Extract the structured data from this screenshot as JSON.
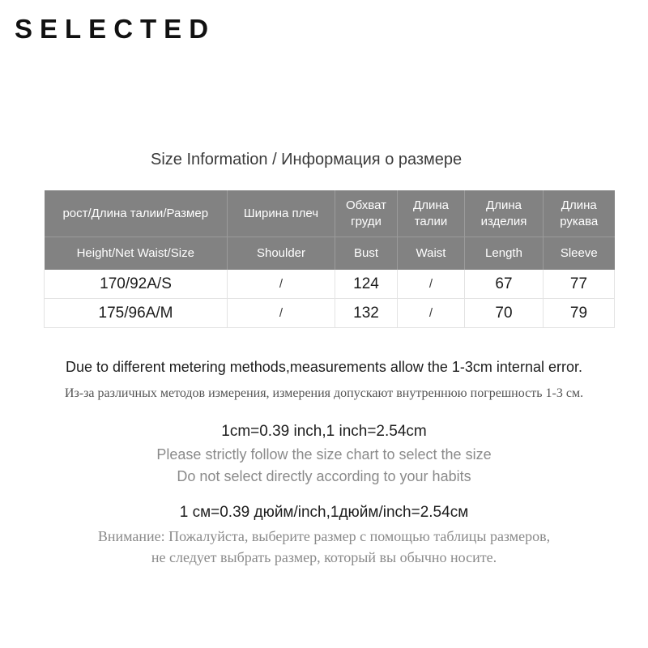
{
  "brand": {
    "name": "SELECTED"
  },
  "section": {
    "title": "Size Information / Информация о размере"
  },
  "table": {
    "headers_ru": [
      "рост/Длина талии/Размер",
      "Ширина плеч",
      "Обхват груди",
      "Длина талии",
      "Длина изделия",
      "Длина рукава"
    ],
    "headers_en": [
      "Height/Net  Waist/Size",
      "Shoulder",
      "Bust",
      "Waist",
      "Length",
      "Sleeve"
    ],
    "rows": [
      {
        "size": "170/92A/S",
        "shoulder": "/",
        "bust": "124",
        "waist": "/",
        "length": "67",
        "sleeve": "77"
      },
      {
        "size": "175/96A/M",
        "shoulder": "/",
        "bust": "132",
        "waist": "/",
        "length": "70",
        "sleeve": "79"
      }
    ],
    "header_bg": "#828282",
    "header_text_color": "#ffffff",
    "grid_color": "#e3e3e3"
  },
  "notes": {
    "error_en": "Due to different metering methods,measurements allow the 1-3cm internal error.",
    "error_ru": "Из-за различных методов измерения, измерения допускают внутреннюю погрешность 1-3 см.",
    "conversion_en": "1cm=0.39 inch,1 inch=2.54cm",
    "advice_en_1": "Please strictly follow the size chart to select the size",
    "advice_en_2": "Do not select directly according to your habits",
    "conversion_ru": "1 см=0.39 дюйм/inch,1дюйм/inch=2.54см",
    "advice_ru_1": "Внимание: Пожалуйста, выберите размер с помощью таблицы размеров,",
    "advice_ru_2": "не следует выбрать размер, который вы обычно носите."
  }
}
